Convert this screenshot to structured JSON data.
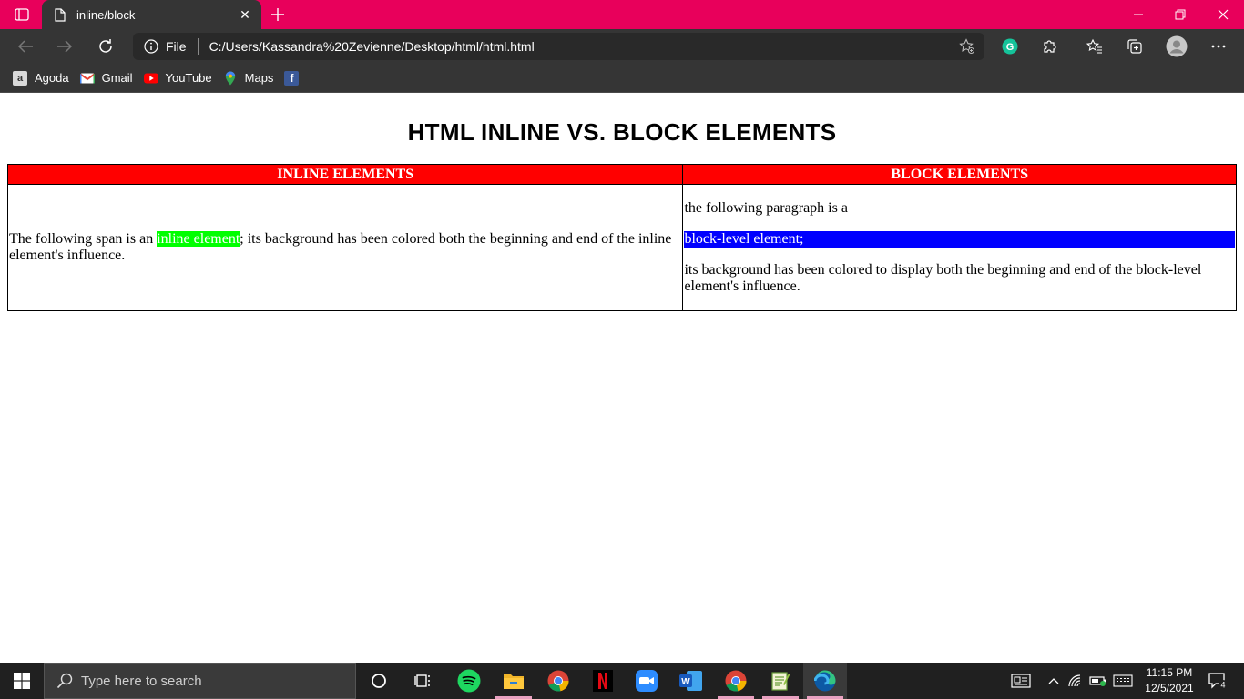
{
  "browser": {
    "tab_title": "inline/block",
    "address_scheme": "File",
    "address_url": "C:/Users/Kassandra%20Zevienne/Desktop/html/html.html",
    "bookmarks": [
      {
        "label": "Agoda",
        "icon": "agoda-icon"
      },
      {
        "label": "Gmail",
        "icon": "gmail-icon"
      },
      {
        "label": "YouTube",
        "icon": "youtube-icon"
      },
      {
        "label": "Maps",
        "icon": "maps-icon"
      },
      {
        "label": "",
        "icon": "facebook-icon"
      }
    ],
    "accent_color": "#e8005b"
  },
  "page": {
    "heading": "HTML INLINE VS. BLOCK ELEMENTS",
    "table": {
      "headers": [
        "INLINE ELEMENTS",
        "BLOCK ELEMENTS"
      ],
      "inline_cell": {
        "before": "The following span is an ",
        "highlight": "inline element",
        "after": "; its background has been colored both the beginning and end of the inline element's influence."
      },
      "block_cell": {
        "para1": "the following paragraph is a",
        "highlight": "block-level element;",
        "para3": "its background has been colored to display both the beginning and end of the block-level element's influence."
      },
      "colors": {
        "header_bg": "#ff0000",
        "inline_highlight": "#00ff00",
        "block_highlight": "#0000ff"
      }
    }
  },
  "taskbar": {
    "search_placeholder": "Type here to search",
    "time": "11:15 PM",
    "date": "12/5/2021",
    "notifications": "4"
  }
}
